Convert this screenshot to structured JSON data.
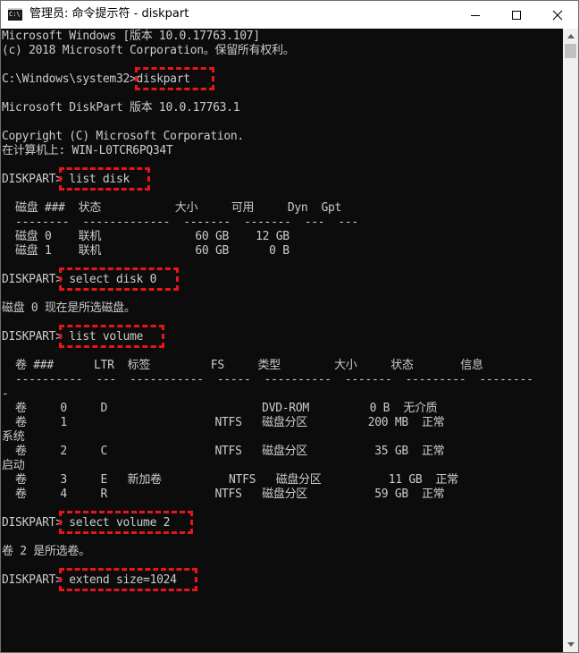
{
  "window": {
    "title": "管理员: 命令提示符 - diskpart",
    "icon_text": "C:\\"
  },
  "console": {
    "lines": [
      "Microsoft Windows [版本 10.0.17763.107]",
      "(c) 2018 Microsoft Corporation。保留所有权利。",
      "",
      "C:\\Windows\\system32>diskpart",
      "",
      "Microsoft DiskPart 版本 10.0.17763.1",
      "",
      "Copyright (C) Microsoft Corporation.",
      "在计算机上: WIN-L0TCR6PQ34T",
      "",
      "DISKPART> list disk",
      "",
      "  磁盘 ###  状态           大小     可用     Dyn  Gpt",
      "  --------  -------------  -------  -------  ---  ---",
      "  磁盘 0    联机              60 GB    12 GB",
      "  磁盘 1    联机              60 GB      0 B",
      "",
      "DISKPART> select disk 0",
      "",
      "磁盘 0 现在是所选磁盘。",
      "",
      "DISKPART> list volume",
      "",
      "  卷 ###      LTR  标签         FS     类型        大小     状态       信息",
      "  ----------  ---  -----------  -----  ----------  -------  ---------  --------",
      "-",
      "  卷     0     D                       DVD-ROM         0 B  无介质",
      "  卷     1                      NTFS   磁盘分区         200 MB  正常",
      "系统",
      "  卷     2     C                NTFS   磁盘分区          35 GB  正常",
      "启动",
      "  卷     3     E   新加卷          NTFS   磁盘分区          11 GB  正常",
      "  卷     4     R                NTFS   磁盘分区          59 GB  正常",
      "",
      "DISKPART> select volume 2",
      "",
      "卷 2 是所选卷。",
      "",
      "DISKPART> extend size=1024",
      "",
      ""
    ]
  },
  "highlights": [
    {
      "name": "highlight-diskpart",
      "text": ">diskpart"
    },
    {
      "name": "highlight-list-disk",
      "text": "> list disk"
    },
    {
      "name": "highlight-select-disk",
      "text": "> select disk 0"
    },
    {
      "name": "highlight-list-volume",
      "text": "> list volume"
    },
    {
      "name": "highlight-select-volume",
      "text": "> select volume 2"
    },
    {
      "name": "highlight-extend-size",
      "text": "> extend size=1024"
    }
  ],
  "colors": {
    "console_bg": "#0c0c0c",
    "console_text": "#cccccc",
    "highlight": "#e8141c",
    "titlebar_bg": "#ffffff"
  },
  "icons": {
    "minimize": "minimize-icon",
    "maximize": "maximize-icon",
    "close": "close-icon",
    "scroll_up": "scroll-up-arrow-icon",
    "scroll_down": "scroll-down-arrow-icon"
  }
}
